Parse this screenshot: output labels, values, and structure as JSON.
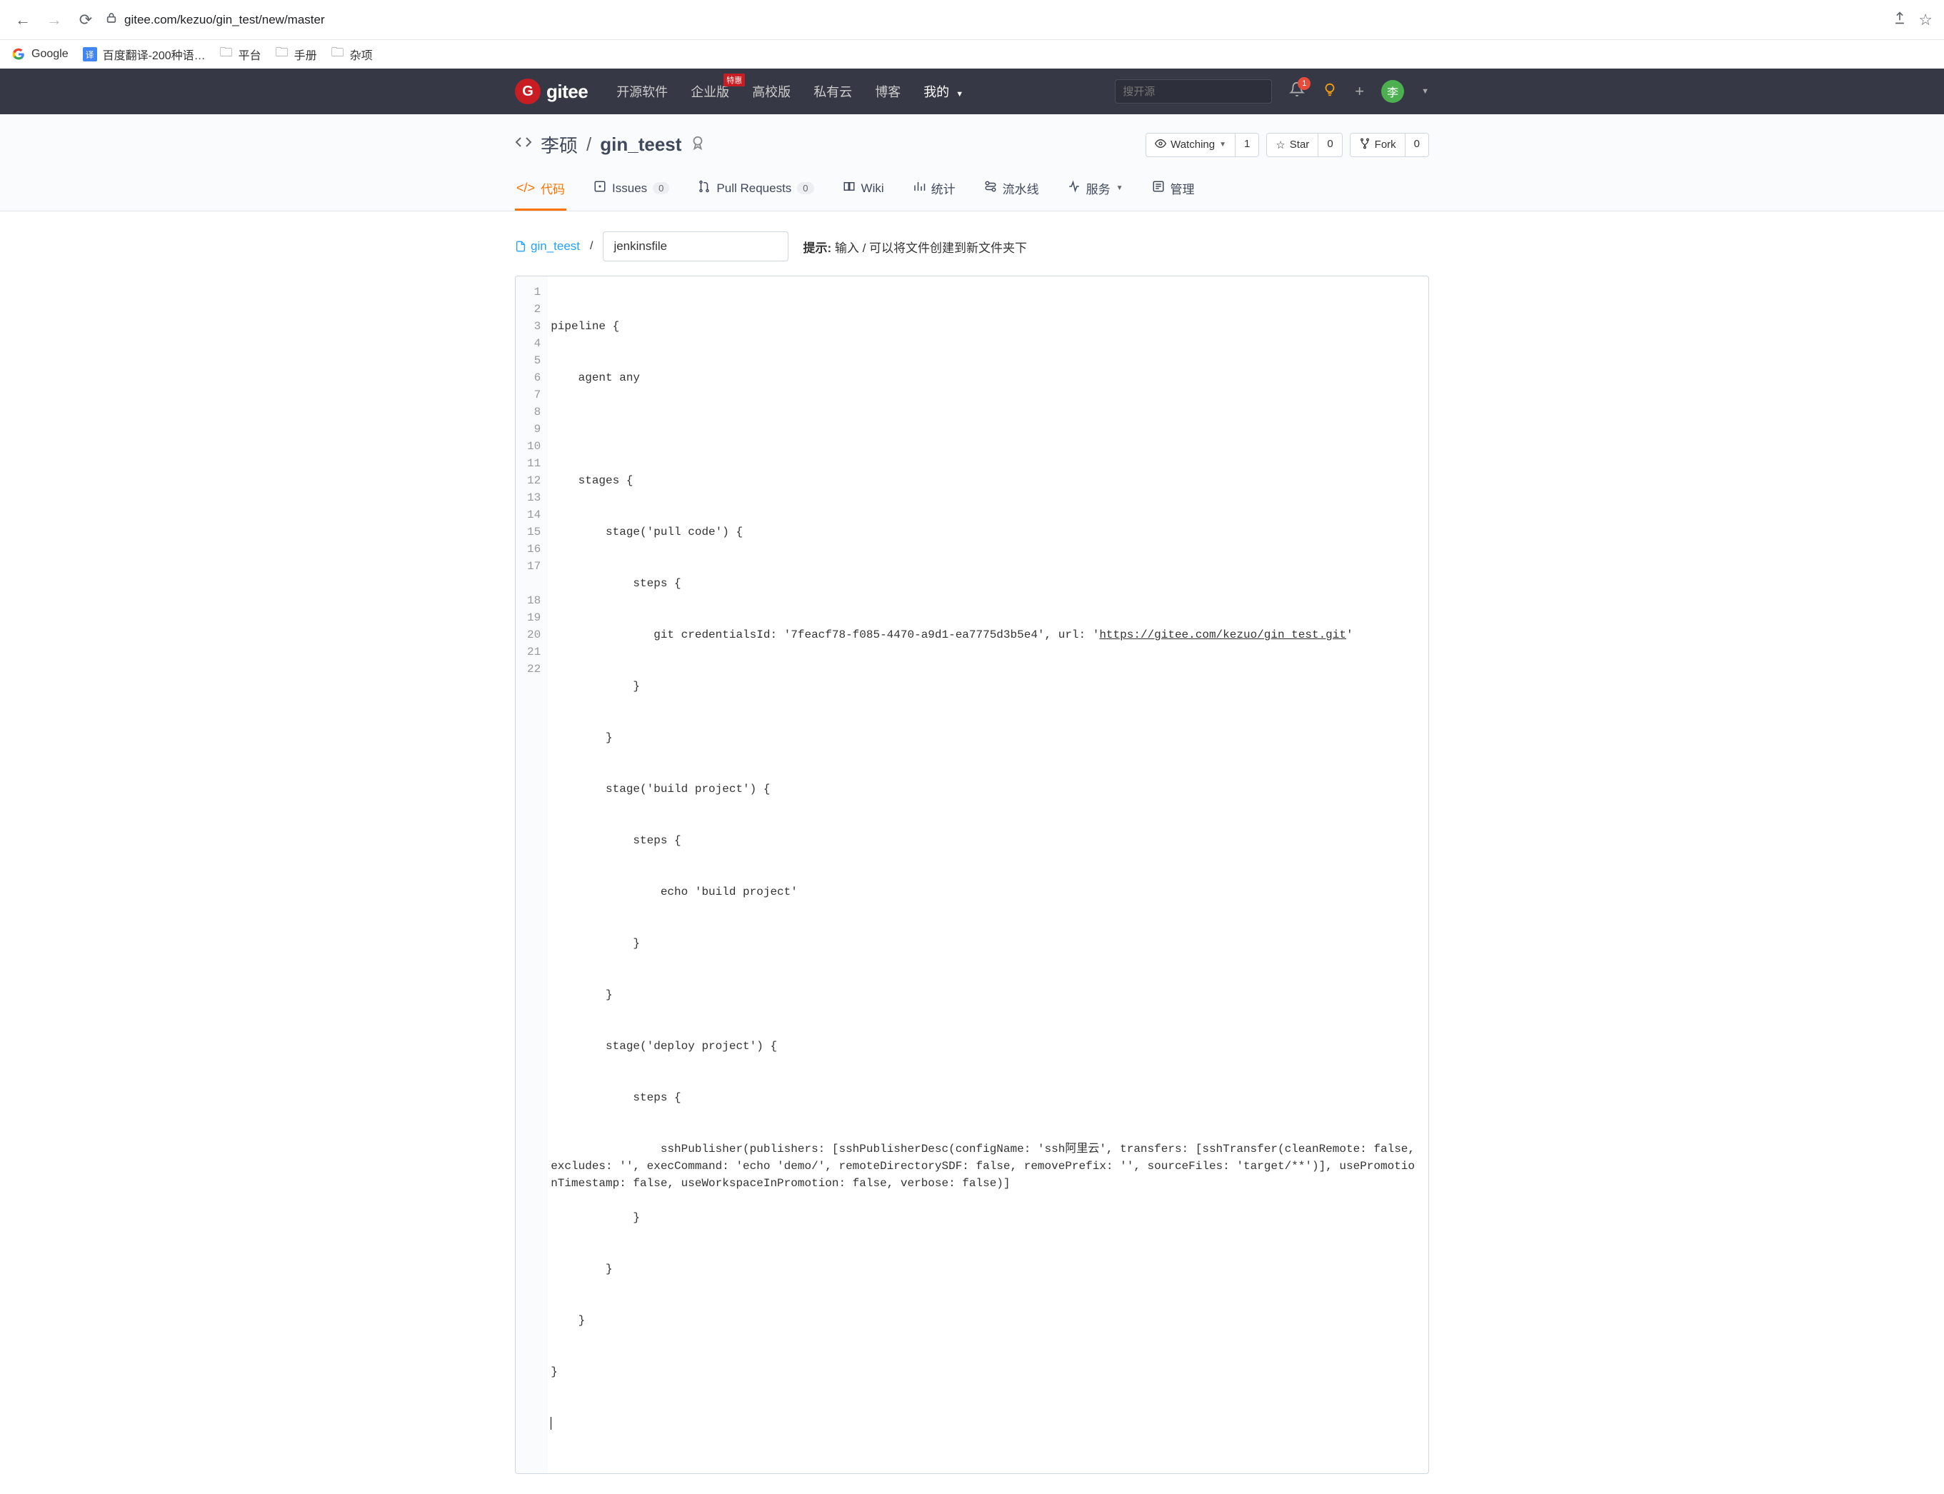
{
  "browser": {
    "url": "gitee.com/kezuo/gin_test/new/master"
  },
  "bookmarks": {
    "google": "Google",
    "translate": "百度翻译-200种语…",
    "platform": "平台",
    "manual": "手册",
    "misc": "杂项"
  },
  "nav": {
    "open_source": "开源软件",
    "enterprise": "企业版",
    "enterprise_badge": "特惠",
    "university": "高校版",
    "private": "私有云",
    "blog": "博客",
    "mine": "我的",
    "search_placeholder": "搜开源",
    "notif_count": "1",
    "avatar_initial": "李"
  },
  "repo": {
    "owner": "李硕",
    "name": "gin_teest",
    "actions": {
      "watching": "Watching",
      "watching_count": "1",
      "star": "Star",
      "star_count": "0",
      "fork": "Fork",
      "fork_count": "0"
    }
  },
  "tabs": {
    "code": "代码",
    "issues": "Issues",
    "issues_count": "0",
    "pr": "Pull Requests",
    "pr_count": "0",
    "wiki": "Wiki",
    "stats": "统计",
    "pipeline": "流水线",
    "services": "服务",
    "admin": "管理"
  },
  "breadcrumb": {
    "root": "gin_teest",
    "filename": "jenkinsfile",
    "hint_label": "提示:",
    "hint_text": "输入 / 可以将文件创建到新文件夹下"
  },
  "editor": {
    "git_url": "https://gitee.com/kezuo/gin_test.git",
    "lines": {
      "l1": "pipeline {",
      "l2": "    agent any",
      "l3": "",
      "l4": "    stages {",
      "l5": "        stage('pull code') {",
      "l6": "            steps {",
      "l7a": "               git credentialsId: '7feacf78-f085-4470-a9d1-ea7775d3b5e4', url: '",
      "l7b": "'",
      "l8": "            }",
      "l9": "        }",
      "l10": "        stage('build project') {",
      "l11": "            steps {",
      "l12": "                echo 'build project'",
      "l13": "            }",
      "l14": "        }",
      "l15": "        stage('deploy project') {",
      "l16": "            steps {",
      "l17": "                sshPublisher(publishers: [sshPublisherDesc(configName: 'ssh阿里云', transfers: [sshTransfer(cleanRemote: false, excludes: '', execCommand: 'echo 'demo/', remoteDirectorySDF: false, removePrefix: '', sourceFiles: 'target/**')], usePromotionTimestamp: false, useWorkspaceInPromotion: false, verbose: false)]",
      "l18": "            }",
      "l19": "        }",
      "l20": "    }",
      "l21": "}",
      "l22": ""
    }
  }
}
